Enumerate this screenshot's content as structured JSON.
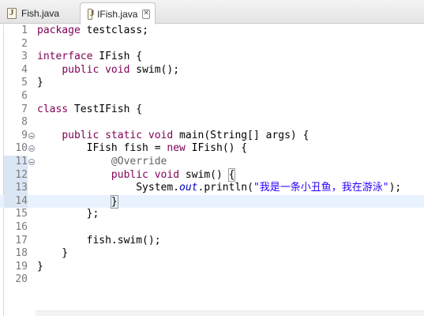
{
  "tabs": [
    {
      "label": "Fish.java",
      "active": false
    },
    {
      "label": "IFish.java",
      "active": true,
      "close_glyph": "✕"
    }
  ],
  "editor": {
    "current_line": 14,
    "lines": [
      {
        "num": "1",
        "text": "package testclass;"
      },
      {
        "num": "2",
        "text": ""
      },
      {
        "num": "3",
        "text": "interface IFish {"
      },
      {
        "num": "4",
        "text": "    public void swim();"
      },
      {
        "num": "5",
        "text": "}"
      },
      {
        "num": "6",
        "text": ""
      },
      {
        "num": "7",
        "text": "class TestIFish {"
      },
      {
        "num": "8",
        "text": ""
      },
      {
        "num": "9",
        "text": "    public static void main(String[] args) {"
      },
      {
        "num": "10",
        "text": "        IFish fish = new IFish() {"
      },
      {
        "num": "11",
        "text": "            @Override"
      },
      {
        "num": "12",
        "text": "            public void swim() {"
      },
      {
        "num": "13",
        "text": "                System.out.println(\"我是一条小丑鱼，我在游泳\");"
      },
      {
        "num": "14",
        "text": "            }"
      },
      {
        "num": "15",
        "text": "        };"
      },
      {
        "num": "16",
        "text": ""
      },
      {
        "num": "17",
        "text": "        fish.swim();"
      },
      {
        "num": "18",
        "text": "    }"
      },
      {
        "num": "19",
        "text": "}"
      },
      {
        "num": "20",
        "text": ""
      }
    ]
  },
  "icons": {
    "file_icon": "java-file-icon",
    "close_icon": "close-icon",
    "fold_icon": "collapse-fold-icon",
    "override_icon": "override-marker-icon"
  },
  "colors": {
    "keyword": "#7f0055",
    "annotation": "#646464",
    "static_field": "#0000c0",
    "string": "#2a00ff",
    "current_line": "#e8f2fe"
  }
}
